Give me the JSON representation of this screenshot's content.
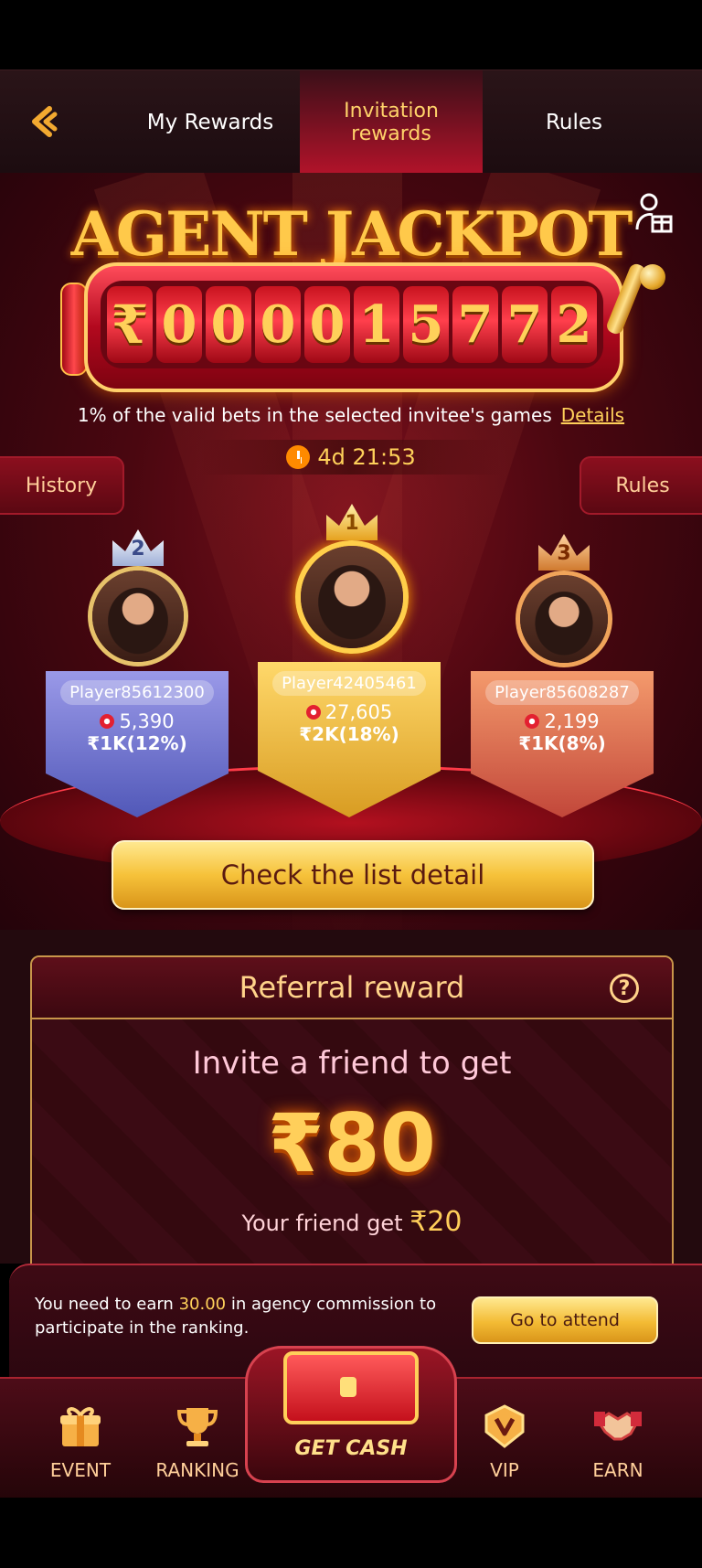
{
  "tabs": {
    "my_rewards": "My Rewards",
    "invitation_rewards": "Invitation rewards",
    "rules": "Rules"
  },
  "jackpot": {
    "title": "AGENT JACKPOT",
    "currency": "₹",
    "digits": [
      "0",
      "0",
      "0",
      "0",
      "1",
      "5",
      "7",
      "7",
      "2"
    ],
    "description": "1% of the valid bets in the selected invitee's games",
    "details_link": "Details",
    "timer": "4d 21:53"
  },
  "side_buttons": {
    "history": "History",
    "rules": "Rules"
  },
  "leaderboard": [
    {
      "rank": "2",
      "name": "Player85612300",
      "score": "5,390",
      "prize": "₹1K(12%)"
    },
    {
      "rank": "1",
      "name": "Player42405461",
      "score": "27,605",
      "prize": "₹2K(18%)"
    },
    {
      "rank": "3",
      "name": "Player85608287",
      "score": "2,199",
      "prize": "₹1K(8%)"
    }
  ],
  "check_list_button": "Check the list detail",
  "referral": {
    "header": "Referral reward",
    "help": "?",
    "invite_text": "Invite a friend to get",
    "amount": "₹80",
    "friend_get_label": "Your friend get",
    "friend_get_amount": "₹20"
  },
  "commission": {
    "text_before": "You need to earn",
    "value": "30.00",
    "text_after": "in agency commission to participate in the ranking.",
    "button": "Go to attend"
  },
  "bottom_nav": {
    "event": "EVENT",
    "ranking": "RANKING",
    "get_cash": "GET CASH",
    "vip": "VIP",
    "earn": "EARN"
  },
  "icons": {
    "back": "back-arrow-icon",
    "invite_person": "person-gift-icon",
    "timer": "alarm-clock-icon",
    "help": "question-circle-icon",
    "event": "gift-box-icon",
    "ranking": "trophy-icon",
    "get_cash": "treasure-chest-icon",
    "vip": "vip-shield-icon",
    "earn": "handshake-icon"
  },
  "colors": {
    "accent_gold": "#ffd15a",
    "deep_red": "#7c0f1c",
    "active_tab": "#b2132a"
  }
}
